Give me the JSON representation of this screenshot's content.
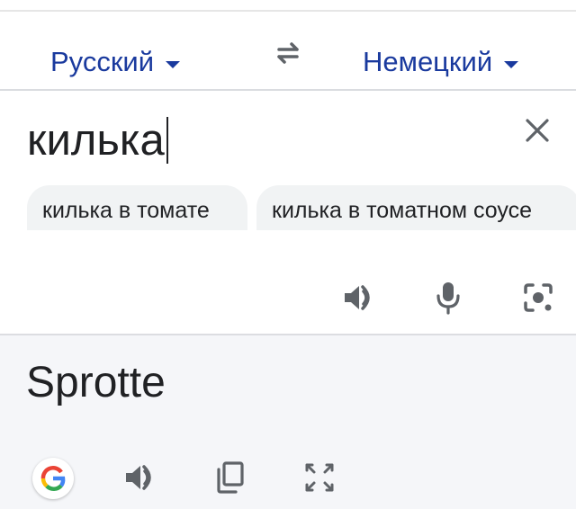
{
  "language_bar": {
    "source_language": "Русский",
    "target_language": "Немецкий",
    "swap_icon": "swap-arrows-icon"
  },
  "input": {
    "text": "килька",
    "clear_icon": "close-icon"
  },
  "suggestions": [
    "килька в томате",
    "килька в томатном соусе"
  ],
  "input_tools": {
    "icons": [
      "speaker-icon",
      "microphone-icon",
      "camera-icon"
    ]
  },
  "output": {
    "text": "Sprotte",
    "icons": [
      "google-logo-icon",
      "speaker-icon",
      "copy-icon",
      "fullscreen-icon"
    ]
  },
  "colors": {
    "accent": "#1a3a9e",
    "icon": "#5f6368",
    "output_background": "#f5f6f9"
  }
}
